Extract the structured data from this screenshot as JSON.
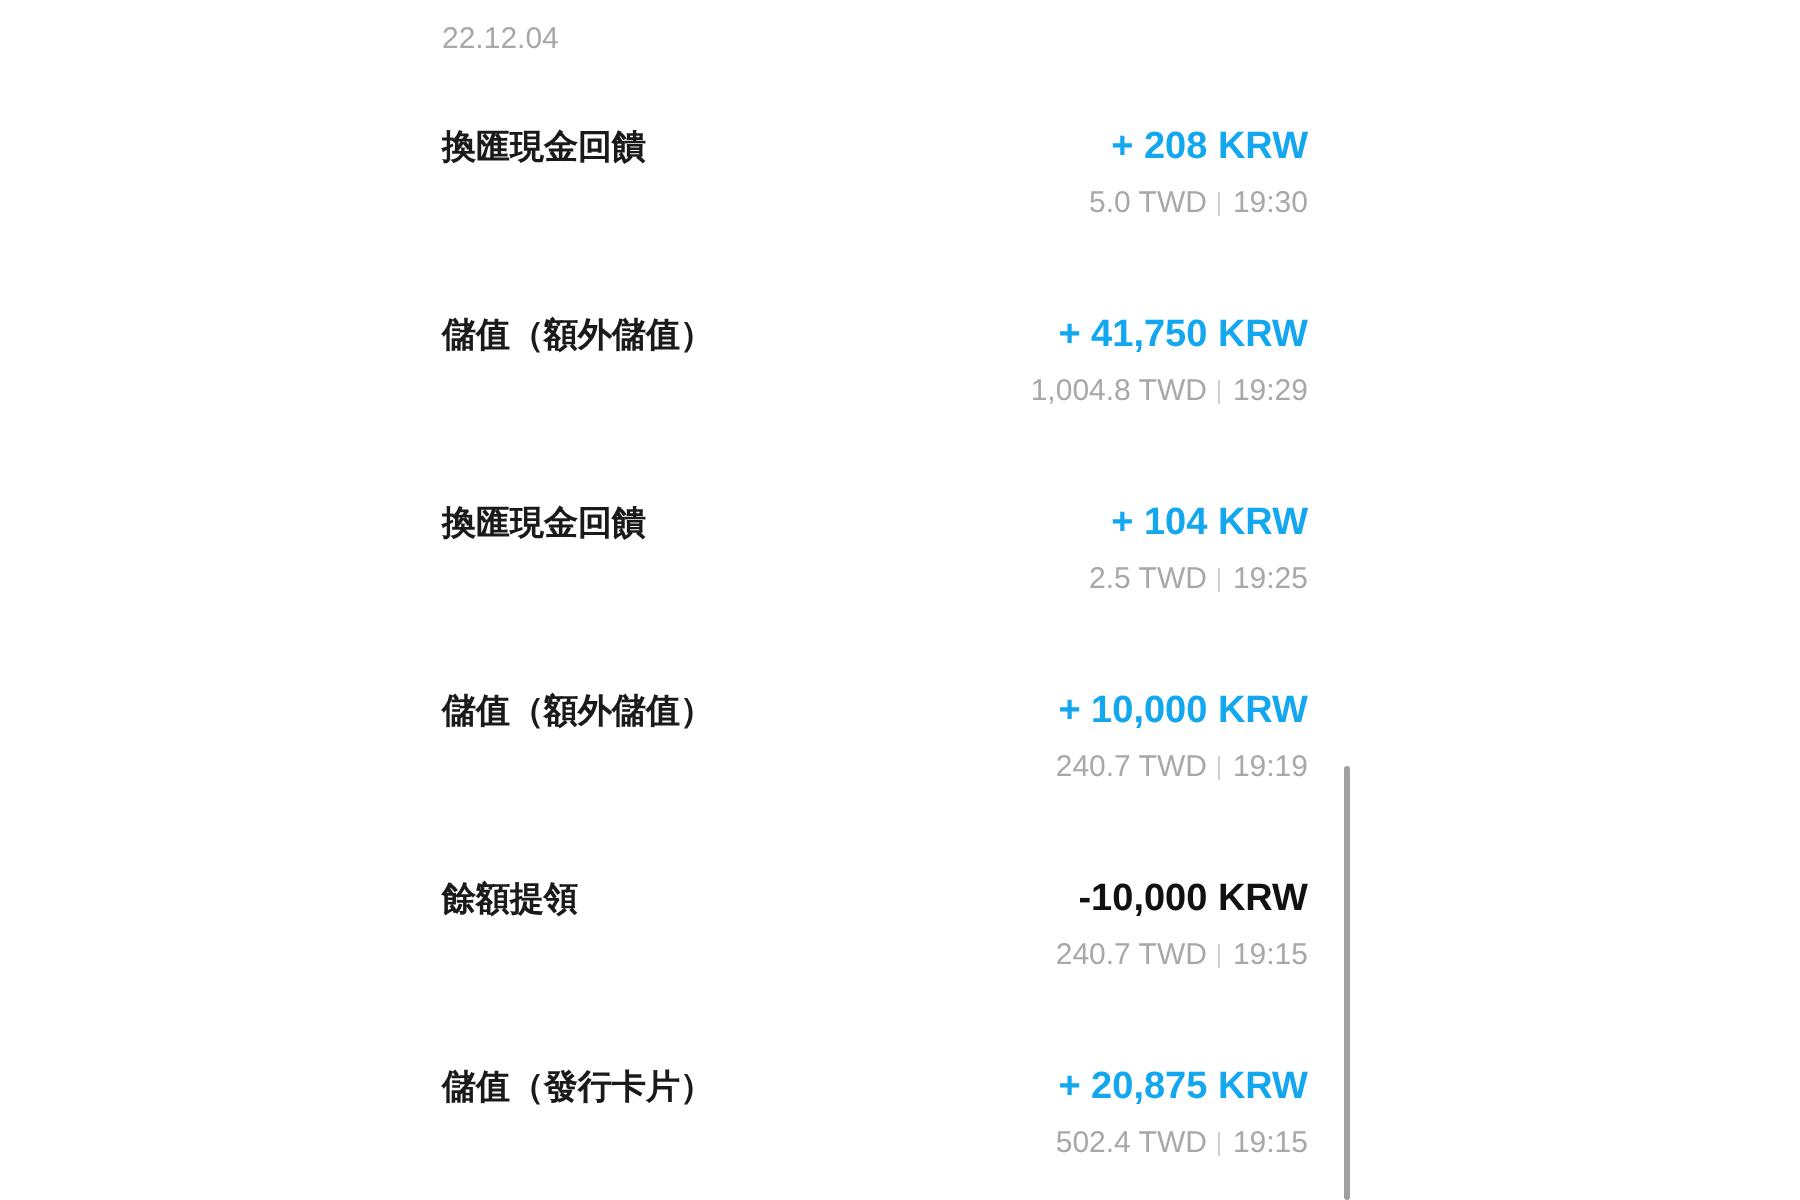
{
  "date": "22.12.04",
  "transactions": [
    {
      "title": "換匯現金回饋",
      "amount": "+ 208 KRW",
      "kind": "credit",
      "twd": "5.0 TWD",
      "time": "19:30"
    },
    {
      "title": "儲值（額外儲值）",
      "amount": "+ 41,750 KRW",
      "kind": "credit",
      "twd": "1,004.8 TWD",
      "time": "19:29"
    },
    {
      "title": "換匯現金回饋",
      "amount": "+ 104 KRW",
      "kind": "credit",
      "twd": "2.5 TWD",
      "time": "19:25"
    },
    {
      "title": "儲值（額外儲值）",
      "amount": "+ 10,000 KRW",
      "kind": "credit",
      "twd": "240.7 TWD",
      "time": "19:19"
    },
    {
      "title": "餘額提領",
      "amount": "-10,000 KRW",
      "kind": "debit",
      "twd": "240.7 TWD",
      "time": "19:15"
    },
    {
      "title": "儲值（發行卡片）",
      "amount": "+ 20,875 KRW",
      "kind": "credit",
      "twd": "502.4 TWD",
      "time": "19:15"
    }
  ]
}
